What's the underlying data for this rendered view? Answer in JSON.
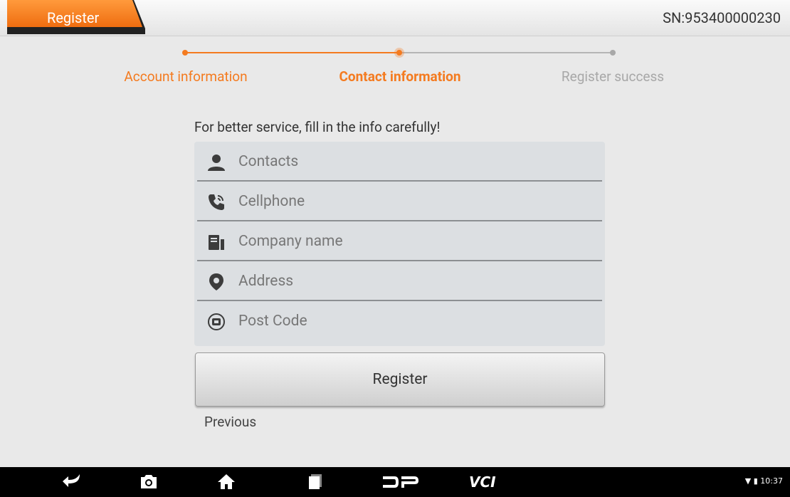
{
  "header": {
    "title": "Register",
    "serial": "SN:953400000230"
  },
  "steps": [
    {
      "label": "Account information",
      "state": "done"
    },
    {
      "label": "Contact information",
      "state": "active"
    },
    {
      "label": "Register success",
      "state": "pending"
    }
  ],
  "form": {
    "hint": "For better service, fill in the info carefully!",
    "fields": [
      {
        "name": "contacts",
        "icon": "person-icon",
        "placeholder": "Contacts",
        "value": ""
      },
      {
        "name": "cellphone",
        "icon": "phone-icon",
        "placeholder": "Cellphone",
        "value": ""
      },
      {
        "name": "company",
        "icon": "company-icon",
        "placeholder": "Company name",
        "value": ""
      },
      {
        "name": "address",
        "icon": "location-pin-icon",
        "placeholder": "Address",
        "value": ""
      },
      {
        "name": "postcode",
        "icon": "postcode-icon",
        "placeholder": "Post Code",
        "value": ""
      }
    ],
    "register_label": "Register",
    "previous_label": "Previous"
  },
  "navbar": {
    "icons": [
      "back-icon",
      "screenshot-icon",
      "home-icon",
      "recent-apps-icon",
      "dp-icon",
      "vci-icon"
    ],
    "time": "10:37"
  },
  "colors": {
    "accent": "#f47b20",
    "pending": "#a8a8a8"
  }
}
